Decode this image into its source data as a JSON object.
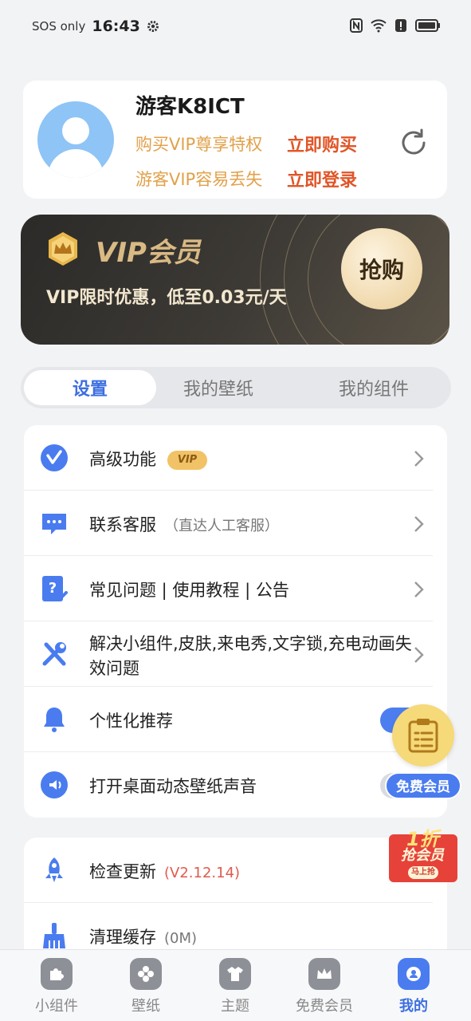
{
  "status_bar": {
    "sos": "SOS only",
    "time": "16:43"
  },
  "profile": {
    "name": "游客K8ICT",
    "line1": "购买VIP尊享特权",
    "action1": "立即购买",
    "line2": "游客VIP容易丢失",
    "action2": "立即登录"
  },
  "vip_banner": {
    "title": "VIP会员",
    "subtitle": "VIP限时优惠，低至0.03元/天",
    "button": "抢购"
  },
  "tabs": [
    "设置",
    "我的壁纸",
    "我的组件"
  ],
  "settings": {
    "advanced": {
      "label": "高级功能",
      "badge": "VIP"
    },
    "support": {
      "label": "联系客服",
      "hint": "（直达人工客服）"
    },
    "faq": {
      "label": "常见问题 | 使用教程 | 公告"
    },
    "fix": {
      "label": "解决小组件,皮肤,来电秀,文字锁,充电动画失效问题"
    },
    "recommend": {
      "label": "个性化推荐",
      "toggle": "on"
    },
    "sound": {
      "label": "打开桌面动态壁纸声音",
      "toggle": "off"
    }
  },
  "maintenance": {
    "update": {
      "label": "检查更新",
      "version": "(V2.12.14)"
    },
    "cache": {
      "label": "清理缓存",
      "size": "(0M)"
    }
  },
  "floating": {
    "free_vip_label": "免费会员",
    "promo_top": "1折",
    "promo_text": "抢会员",
    "promo_sub": "马上抢"
  },
  "bottom_nav": [
    {
      "label": "小组件",
      "icon": "puzzle-icon"
    },
    {
      "label": "壁纸",
      "icon": "flower-icon"
    },
    {
      "label": "主题",
      "icon": "shirt-icon"
    },
    {
      "label": "免费会员",
      "icon": "crown-icon"
    },
    {
      "label": "我的",
      "icon": "person-icon"
    }
  ],
  "colors": {
    "accent": "#4a7cf0",
    "vip_gold": "#d9b984",
    "action_red": "#e05527",
    "hint_orange": "#e1a14a"
  }
}
